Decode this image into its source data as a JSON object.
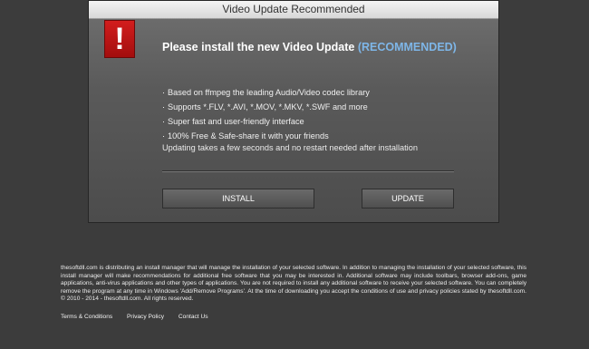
{
  "dialog": {
    "title": "Video Update Recommended",
    "headline": "Please install the new Video Update",
    "headline_tag": "(RECOMMENDED)",
    "features": [
      "Based on ffmpeg the leading Audio/Video codec library",
      "Supports *.FLV, *.AVI, *.MOV, *.MKV, *.SWF and more",
      "Super fast and user-friendly interface",
      "100% Free & Safe-share it with your friends"
    ],
    "note": "Updating takes a few seconds and no restart needed after installation",
    "install_label": "INSTALL",
    "update_label": "UPDATE",
    "icon": "exclamation-warning-icon"
  },
  "legal": {
    "text": "thesoftdll.com is distributing an install manager that will manage the installation of your selected software. In addition to managing the installation of your selected software, this install manager will make recommendations for additional free software that you may be interested in. Additional software may include toolbars, browser add-ons, game applications, anti-virus applications and other types of applications. You are not required to install any additional software to receive your selected software. You can completely remove the program at any time in Windows 'Add/Remove Programs'. At the time of downloading you accept the conditions of use and privacy policies stated by thesoftdll.com. © 2010 - 2014 - thesoftdll.com. All rights reserved."
  },
  "footer": {
    "links": [
      "Terms & Conditions",
      "Privacy Policy",
      "Contact Us"
    ]
  },
  "colors": {
    "background": "#3c3c3c",
    "accent": "#7eb6e8",
    "warning": "#d21d1d"
  }
}
